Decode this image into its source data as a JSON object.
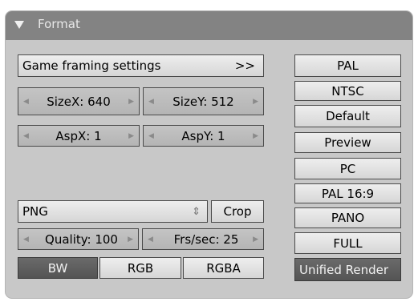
{
  "panel": {
    "title": "Format"
  },
  "framing": {
    "label": "Game framing settings",
    "arrow": ">>"
  },
  "size": {
    "x": "SizeX: 640",
    "y": "SizeY: 512"
  },
  "asp": {
    "x": "AspX: 1",
    "y": "AspY: 1"
  },
  "image_format": {
    "value": "PNG",
    "crop": "Crop"
  },
  "quality": "Quality: 100",
  "fps": "Frs/sec: 25",
  "color_modes": [
    "BW",
    "RGB",
    "RGBA"
  ],
  "active_color_mode": "BW",
  "presets": [
    "PAL",
    "NTSC",
    "Default",
    "Preview",
    "PC",
    "PAL 16:9",
    "PANO",
    "FULL",
    "Unified Render"
  ],
  "active_preset": "Unified Render",
  "arrows": {
    "left": "◀",
    "right": "▶",
    "updown": "⇕"
  }
}
